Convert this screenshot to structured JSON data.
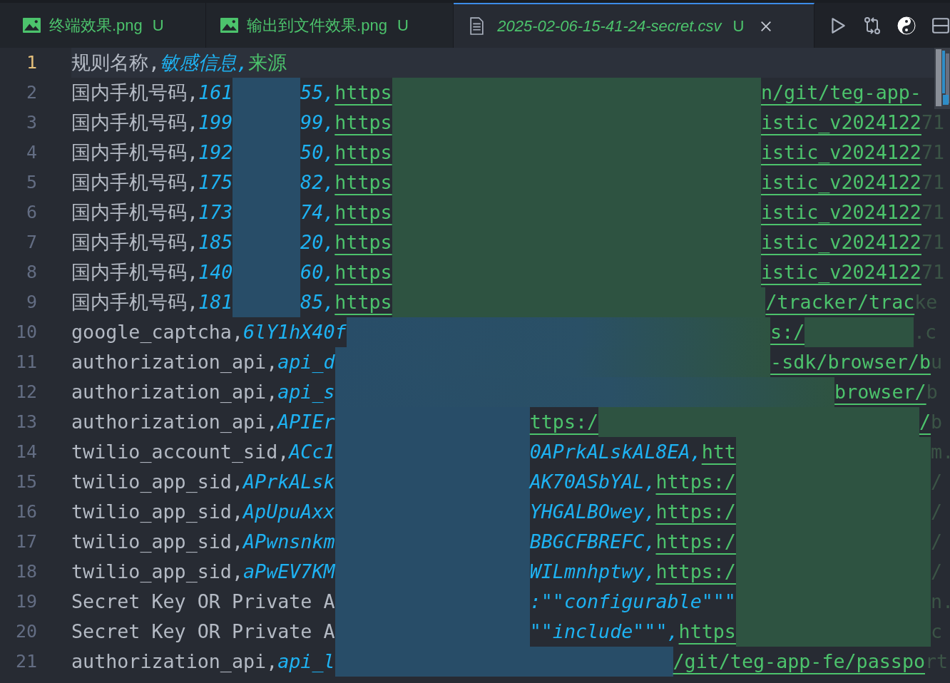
{
  "tabs": [
    {
      "label": "终端效果.png",
      "status": "U",
      "kind": "image",
      "selected": false,
      "preview": false
    },
    {
      "label": "输出到文件效果.png",
      "status": "U",
      "kind": "image",
      "selected": false,
      "preview": false
    },
    {
      "label": "2025-02-06-15-41-24-secret.csv",
      "status": "U",
      "kind": "text",
      "selected": true,
      "preview": true
    }
  ],
  "toolbar": [
    {
      "kind": "run"
    },
    {
      "kind": "compare"
    },
    {
      "kind": "yinyang"
    },
    {
      "kind": "split"
    }
  ],
  "lines": [
    {
      "number": "1",
      "current": true,
      "segments": [
        {
          "kind": "key",
          "text": "规则名称,"
        },
        {
          "kind": "value",
          "text": "敏感信息,"
        },
        {
          "kind": "source",
          "text": "来源"
        }
      ]
    },
    {
      "number": "2",
      "current": false,
      "segments": [
        {
          "kind": "key",
          "text": "国内手机号码,"
        },
        {
          "kind": "value",
          "text": "161"
        },
        {
          "kind": "redacted"
        },
        {
          "kind": "value",
          "text": "55,"
        },
        {
          "kind": "link",
          "text": "https"
        },
        {
          "kind": "redacted"
        },
        {
          "kind": "link",
          "text": "n/git/teg-app-"
        }
      ]
    },
    {
      "number": "3",
      "current": false,
      "segments": [
        {
          "kind": "key",
          "text": "国内手机号码,"
        },
        {
          "kind": "value",
          "text": "199"
        },
        {
          "kind": "redacted"
        },
        {
          "kind": "value",
          "text": "99,"
        },
        {
          "kind": "link",
          "text": "https"
        },
        {
          "kind": "redacted"
        },
        {
          "kind": "link",
          "text": "istic_v2024122"
        },
        {
          "kind": "faded",
          "text": "71"
        }
      ]
    },
    {
      "number": "4",
      "current": false,
      "segments": [
        {
          "kind": "key",
          "text": "国内手机号码,"
        },
        {
          "kind": "value",
          "text": "192"
        },
        {
          "kind": "redacted"
        },
        {
          "kind": "value",
          "text": "50,"
        },
        {
          "kind": "link",
          "text": "https"
        },
        {
          "kind": "redacted"
        },
        {
          "kind": "link",
          "text": "istic_v2024122"
        },
        {
          "kind": "faded",
          "text": "71"
        }
      ]
    },
    {
      "number": "5",
      "current": false,
      "segments": [
        {
          "kind": "key",
          "text": "国内手机号码,"
        },
        {
          "kind": "value",
          "text": "175"
        },
        {
          "kind": "redacted"
        },
        {
          "kind": "value",
          "text": "82,"
        },
        {
          "kind": "link",
          "text": "https"
        },
        {
          "kind": "redacted"
        },
        {
          "kind": "link",
          "text": "istic_v2024122"
        },
        {
          "kind": "faded",
          "text": "71"
        }
      ]
    },
    {
      "number": "6",
      "current": false,
      "segments": [
        {
          "kind": "key",
          "text": "国内手机号码,"
        },
        {
          "kind": "value",
          "text": "173"
        },
        {
          "kind": "redacted"
        },
        {
          "kind": "value",
          "text": "74,"
        },
        {
          "kind": "link",
          "text": "https"
        },
        {
          "kind": "redacted"
        },
        {
          "kind": "link",
          "text": "istic_v2024122"
        },
        {
          "kind": "faded",
          "text": "71"
        }
      ]
    },
    {
      "number": "7",
      "current": false,
      "segments": [
        {
          "kind": "key",
          "text": "国内手机号码,"
        },
        {
          "kind": "value",
          "text": "185"
        },
        {
          "kind": "redacted"
        },
        {
          "kind": "value",
          "text": "20,"
        },
        {
          "kind": "link",
          "text": "https"
        },
        {
          "kind": "redacted"
        },
        {
          "kind": "link",
          "text": "istic_v2024122"
        },
        {
          "kind": "faded",
          "text": "71"
        }
      ]
    },
    {
      "number": "8",
      "current": false,
      "segments": [
        {
          "kind": "key",
          "text": "国内手机号码,"
        },
        {
          "kind": "value",
          "text": "140"
        },
        {
          "kind": "redacted"
        },
        {
          "kind": "value",
          "text": "60,"
        },
        {
          "kind": "link",
          "text": "https"
        },
        {
          "kind": "redacted"
        },
        {
          "kind": "link",
          "text": "istic_v2024122"
        },
        {
          "kind": "faded",
          "text": "71"
        }
      ]
    },
    {
      "number": "9",
      "current": false,
      "segments": [
        {
          "kind": "key",
          "text": "国内手机号码,"
        },
        {
          "kind": "value",
          "text": "181"
        },
        {
          "kind": "redacted"
        },
        {
          "kind": "value",
          "text": "85,"
        },
        {
          "kind": "link",
          "text": "https"
        },
        {
          "kind": "redacted"
        },
        {
          "kind": "link",
          "text": "/tracker/trac"
        },
        {
          "kind": "faded",
          "text": "ke"
        }
      ]
    },
    {
      "number": "10",
      "current": false,
      "segments": [
        {
          "kind": "key",
          "text": "google_captcha,"
        },
        {
          "kind": "value",
          "text": "6lY1hX40f"
        },
        {
          "kind": "redacted"
        },
        {
          "kind": "link",
          "text": "s:/"
        },
        {
          "kind": "redacted"
        },
        {
          "kind": "faded",
          "text": ".c"
        }
      ]
    },
    {
      "number": "11",
      "current": false,
      "segments": [
        {
          "kind": "key",
          "text": "authorization_api,"
        },
        {
          "kind": "value",
          "text": "api_d"
        },
        {
          "kind": "redacted"
        },
        {
          "kind": "link",
          "text": "-sdk/browser/b"
        },
        {
          "kind": "faded",
          "text": "u"
        }
      ]
    },
    {
      "number": "12",
      "current": false,
      "segments": [
        {
          "kind": "key",
          "text": "authorization_api,"
        },
        {
          "kind": "value",
          "text": "api_s"
        },
        {
          "kind": "redacted"
        },
        {
          "kind": "link",
          "text": "browser/"
        },
        {
          "kind": "faded",
          "text": "b"
        }
      ]
    },
    {
      "number": "13",
      "current": false,
      "segments": [
        {
          "kind": "key",
          "text": "authorization_api,"
        },
        {
          "kind": "value",
          "text": "APIEr"
        },
        {
          "kind": "redacted"
        },
        {
          "kind": "link",
          "text": "ttps:/"
        },
        {
          "kind": "redacted"
        },
        {
          "kind": "link",
          "text": "/"
        },
        {
          "kind": "faded",
          "text": "b"
        }
      ]
    },
    {
      "number": "14",
      "current": false,
      "segments": [
        {
          "kind": "key",
          "text": "twilio_account_sid,"
        },
        {
          "kind": "value",
          "text": "ACc1"
        },
        {
          "kind": "redacted"
        },
        {
          "kind": "value",
          "text": "0APrkALskAL8EA,"
        },
        {
          "kind": "link",
          "text": "htt"
        },
        {
          "kind": "redacted"
        },
        {
          "kind": "faded",
          "text": "m."
        }
      ]
    },
    {
      "number": "15",
      "current": false,
      "segments": [
        {
          "kind": "key",
          "text": "twilio_app_sid,"
        },
        {
          "kind": "value",
          "text": "APrkALsk"
        },
        {
          "kind": "redacted"
        },
        {
          "kind": "value",
          "text": "AK70ASbYAL,"
        },
        {
          "kind": "link",
          "text": "https:/"
        },
        {
          "kind": "redacted"
        },
        {
          "kind": "faded",
          "text": "/"
        }
      ]
    },
    {
      "number": "16",
      "current": false,
      "segments": [
        {
          "kind": "key",
          "text": "twilio_app_sid,"
        },
        {
          "kind": "value",
          "text": "ApUpuAxx"
        },
        {
          "kind": "redacted"
        },
        {
          "kind": "value",
          "text": "YHGALBOwey,"
        },
        {
          "kind": "link",
          "text": "https:/"
        },
        {
          "kind": "redacted"
        },
        {
          "kind": "faded",
          "text": "/"
        }
      ]
    },
    {
      "number": "17",
      "current": false,
      "segments": [
        {
          "kind": "key",
          "text": "twilio_app_sid,"
        },
        {
          "kind": "value",
          "text": "APwnsnkm"
        },
        {
          "kind": "redacted"
        },
        {
          "kind": "value",
          "text": "BBGCFBREFC,"
        },
        {
          "kind": "link",
          "text": "https:/"
        },
        {
          "kind": "redacted"
        },
        {
          "kind": "faded",
          "text": "/"
        }
      ]
    },
    {
      "number": "18",
      "current": false,
      "segments": [
        {
          "kind": "key",
          "text": "twilio_app_sid,"
        },
        {
          "kind": "value",
          "text": "aPwEV7KM"
        },
        {
          "kind": "redacted"
        },
        {
          "kind": "value",
          "text": "WILmnhptwy,"
        },
        {
          "kind": "link",
          "text": "https:/"
        },
        {
          "kind": "redacted"
        },
        {
          "kind": "faded",
          "text": "/"
        }
      ]
    },
    {
      "number": "19",
      "current": false,
      "segments": [
        {
          "kind": "key",
          "text": "Secret Key OR Private A"
        },
        {
          "kind": "redacted"
        },
        {
          "kind": "value",
          "text": ":\"\"configurable\"\"\""
        },
        {
          "kind": "redacted"
        },
        {
          "kind": "faded",
          "text": "n."
        }
      ]
    },
    {
      "number": "20",
      "current": false,
      "segments": [
        {
          "kind": "key",
          "text": "Secret Key OR Private A"
        },
        {
          "kind": "redacted"
        },
        {
          "kind": "value",
          "text": "\"\"include\"\"\","
        },
        {
          "kind": "link",
          "text": "https"
        },
        {
          "kind": "redacted"
        },
        {
          "kind": "faded",
          "text": "c"
        }
      ]
    },
    {
      "number": "21",
      "current": false,
      "segments": [
        {
          "kind": "key",
          "text": "authorization_api,"
        },
        {
          "kind": "value",
          "text": "api_l"
        },
        {
          "kind": "redacted"
        },
        {
          "kind": "link",
          "text": "/git/teg-app-fe/passpo"
        },
        {
          "kind": "faded",
          "text": "rt"
        }
      ]
    }
  ]
}
